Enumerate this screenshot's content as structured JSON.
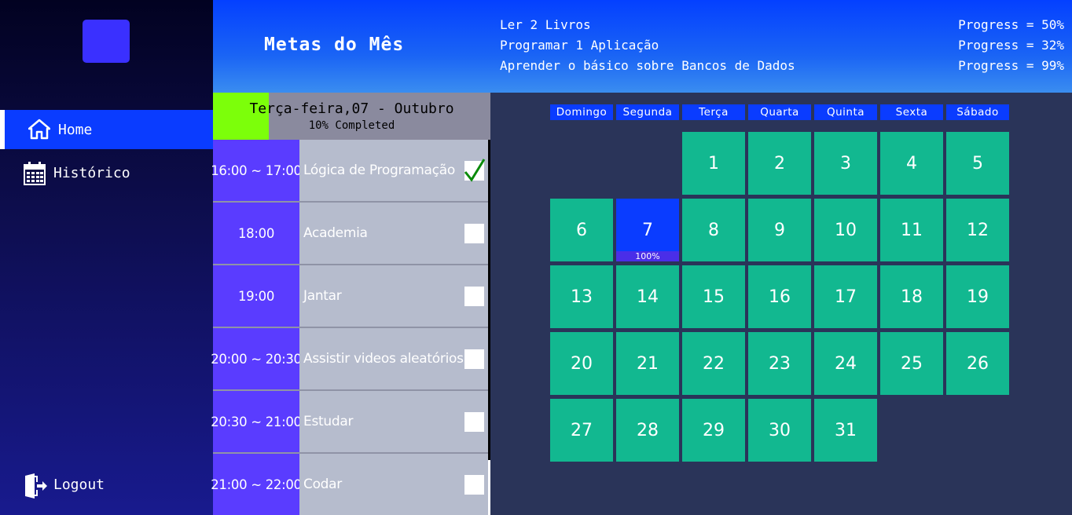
{
  "sidebar": {
    "nav": [
      {
        "label": "Home",
        "icon": "home-icon",
        "active": true
      },
      {
        "label": "Histórico",
        "icon": "calendar-icon",
        "active": false
      }
    ],
    "logout_label": "Logout"
  },
  "header": {
    "title": "Metas do Mês",
    "goals": [
      {
        "name": "Ler 2 Livros",
        "progress_label": "Progress = 50%"
      },
      {
        "name": "Programar 1 Aplicação",
        "progress_label": "Progress = 32%"
      },
      {
        "name": "Aprender o básico sobre Bancos de Dados",
        "progress_label": "Progress = 99%"
      }
    ]
  },
  "day_panel": {
    "title": "Terça-feira,07 - Outubro",
    "completed_label": "10% Completed",
    "completed_fraction": 0.2,
    "tasks": [
      {
        "time": "16:00 ~ 17:00",
        "name": "Lógica de Programação",
        "done": true
      },
      {
        "time": "18:00",
        "name": "Academia",
        "done": false
      },
      {
        "time": "19:00",
        "name": "Jantar",
        "done": false
      },
      {
        "time": "20:00 ~ 20:30",
        "name": "Assistir videos aleatórios",
        "done": false
      },
      {
        "time": "20:30 ~ 21:00",
        "name": "Estudar",
        "done": false
      },
      {
        "time": "21:00 ~ 22:00",
        "name": "Codar",
        "done": false
      }
    ]
  },
  "calendar": {
    "weekdays": [
      "Domingo",
      "Segunda",
      "Terça",
      "Quarta",
      "Quinta",
      "Sexta",
      "Sábado"
    ],
    "first_weekday_index": 2,
    "days_in_month": 31,
    "today": 7,
    "today_label": "100%"
  },
  "colors": {
    "accent": "#0a3cff",
    "day_cell": "#12b890",
    "task_time": "#5a3cff",
    "progress_fill": "#7cff0a"
  }
}
